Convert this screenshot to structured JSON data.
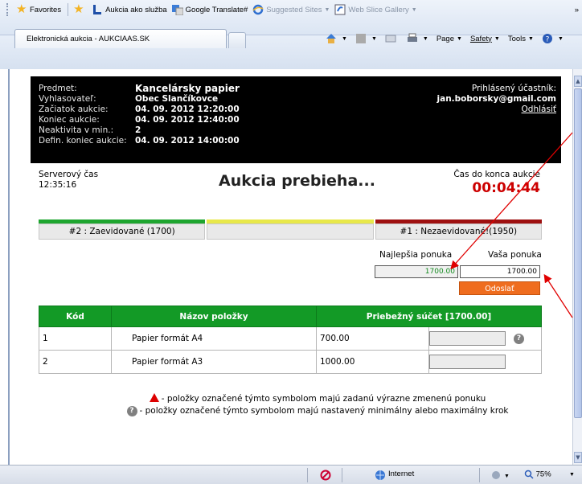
{
  "browser": {
    "favorites_label": "Favorites",
    "fav_links": [
      {
        "label": "Aukcia ako služba",
        "dim": false
      },
      {
        "label": "Google Translate#",
        "dim": false
      },
      {
        "label": "Suggested Sites",
        "dim": true
      },
      {
        "label": "Web Slice Gallery",
        "dim": true
      }
    ],
    "tab_title": "Elektronická aukcia - AUKCIAAS.SK",
    "commands": {
      "page": "Page",
      "safety": "Safety",
      "tools": "Tools"
    },
    "status_zone": "Internet",
    "zoom": "75%"
  },
  "auction": {
    "labels": {
      "subject": "Predmet:",
      "announcer": "Vyhlasovateľ:",
      "start": "Začiatok aukcie:",
      "end": "Koniec aukcie:",
      "inactivity": "Neaktivita v min.:",
      "final_end": "Defin. koniec aukcie:"
    },
    "values": {
      "subject": "Kancelársky papier",
      "announcer": "Obec Slančíkovce",
      "start": "04. 09. 2012 12:20:00",
      "end": "04. 09. 2012 12:40:00",
      "inactivity": "2",
      "final_end": "04. 09. 2012 14:00:00"
    },
    "participant_label": "Prihlásený účastník:",
    "participant_email": "jan.boborsky@gmail.com",
    "logout": "Odhlásiť",
    "server_time_label": "Serverový čas",
    "server_time": "12:35:16",
    "status": "Aukcia prebieha...",
    "time_left_label": "Čas do konca aukcie",
    "time_left": "00:04:44",
    "colors": {
      "green": "#1ea52f",
      "yellow": "#e8e84a",
      "red": "#9e1010",
      "header": "#139a26",
      "send": "#ef6d1f"
    },
    "ranks": {
      "left": "#2 : Zaevidované (1700)",
      "middle": "",
      "right": "#1 : Nezaevidované!(1950)"
    },
    "best_offer_label": "Najlepšia ponuka",
    "your_offer_label": "Vaša ponuka",
    "best_offer": "1700.00",
    "your_offer": "1700.00",
    "send": "Odoslať"
  },
  "table": {
    "headers": {
      "code": "Kód",
      "name": "Názov položky",
      "sum": "Priebežný súčet [1700.00]"
    },
    "rows": [
      {
        "code": "1",
        "name": "Papier formát A4",
        "value": "700.00"
      },
      {
        "code": "2",
        "name": "Papier formát A3",
        "value": "1000.00"
      }
    ]
  },
  "legend": {
    "warning": "- položky označené týmto symbolom majú zadanú výrazne zmenenú ponuku",
    "step": "- položky označené týmto symbolom majú nastavený minimálny alebo maximálny krok"
  }
}
